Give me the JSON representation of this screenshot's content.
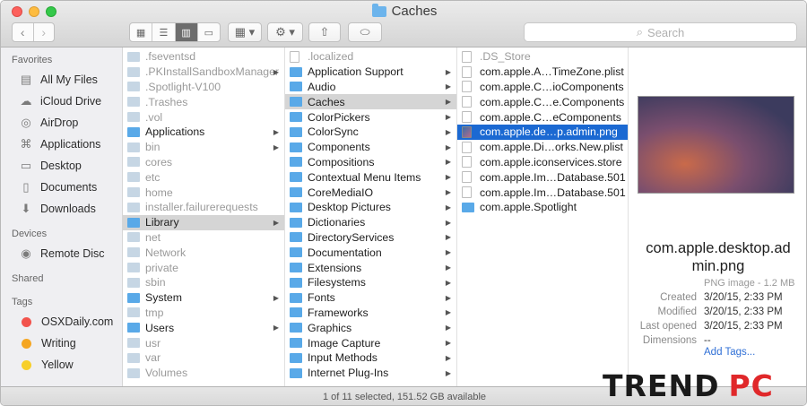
{
  "window": {
    "title": "Caches"
  },
  "toolbar": {
    "search_placeholder": "Search",
    "search_icon": "magnifier"
  },
  "sidebar": {
    "favorites_header": "Favorites",
    "favorites": [
      {
        "label": "All My Files",
        "icon": "all-files-icon"
      },
      {
        "label": "iCloud Drive",
        "icon": "cloud-icon"
      },
      {
        "label": "AirDrop",
        "icon": "airdrop-icon"
      },
      {
        "label": "Applications",
        "icon": "applications-icon"
      },
      {
        "label": "Desktop",
        "icon": "desktop-icon"
      },
      {
        "label": "Documents",
        "icon": "documents-icon"
      },
      {
        "label": "Downloads",
        "icon": "downloads-icon"
      }
    ],
    "devices_header": "Devices",
    "devices": [
      {
        "label": "Remote Disc",
        "icon": "disc-icon"
      }
    ],
    "shared_header": "Shared",
    "tags_header": "Tags",
    "tags": [
      {
        "label": "OSXDaily.com",
        "color": "#f2534c"
      },
      {
        "label": "Writing",
        "color": "#f5a623"
      },
      {
        "label": "Yellow",
        "color": "#f7cf2a"
      }
    ]
  },
  "columns": {
    "col1": [
      {
        "label": ".fseventsd",
        "dim": true,
        "arrow": false
      },
      {
        "label": ".PKInstallSandboxManager",
        "dim": true,
        "arrow": true
      },
      {
        "label": ".Spotlight-V100",
        "dim": true,
        "arrow": false
      },
      {
        "label": ".Trashes",
        "dim": true,
        "arrow": false
      },
      {
        "label": ".vol",
        "dim": true,
        "arrow": false
      },
      {
        "label": "Applications",
        "dim": false,
        "arrow": true
      },
      {
        "label": "bin",
        "dim": true,
        "arrow": true
      },
      {
        "label": "cores",
        "dim": true,
        "arrow": false
      },
      {
        "label": "etc",
        "dim": true,
        "arrow": false
      },
      {
        "label": "home",
        "dim": true,
        "arrow": false
      },
      {
        "label": "installer.failurerequests",
        "dim": true,
        "arrow": false
      },
      {
        "label": "Library",
        "dim": false,
        "arrow": true,
        "selected": true
      },
      {
        "label": "net",
        "dim": true,
        "arrow": false
      },
      {
        "label": "Network",
        "dim": true,
        "arrow": false
      },
      {
        "label": "private",
        "dim": true,
        "arrow": false
      },
      {
        "label": "sbin",
        "dim": true,
        "arrow": false
      },
      {
        "label": "System",
        "dim": false,
        "arrow": true
      },
      {
        "label": "tmp",
        "dim": true,
        "arrow": false
      },
      {
        "label": "Users",
        "dim": false,
        "arrow": true
      },
      {
        "label": "usr",
        "dim": true,
        "arrow": false
      },
      {
        "label": "var",
        "dim": true,
        "arrow": false
      },
      {
        "label": "Volumes",
        "dim": true,
        "arrow": false
      }
    ],
    "col2": [
      {
        "label": ".localized",
        "dim": true,
        "arrow": false,
        "file": true
      },
      {
        "label": "Application Support",
        "arrow": true
      },
      {
        "label": "Audio",
        "arrow": true
      },
      {
        "label": "Caches",
        "arrow": true,
        "selected": true
      },
      {
        "label": "ColorPickers",
        "arrow": true
      },
      {
        "label": "ColorSync",
        "arrow": true
      },
      {
        "label": "Components",
        "arrow": true
      },
      {
        "label": "Compositions",
        "arrow": true
      },
      {
        "label": "Contextual Menu Items",
        "arrow": true
      },
      {
        "label": "CoreMediaIO",
        "arrow": true
      },
      {
        "label": "Desktop Pictures",
        "arrow": true
      },
      {
        "label": "Dictionaries",
        "arrow": true
      },
      {
        "label": "DirectoryServices",
        "arrow": true
      },
      {
        "label": "Documentation",
        "arrow": true
      },
      {
        "label": "Extensions",
        "arrow": true
      },
      {
        "label": "Filesystems",
        "arrow": true
      },
      {
        "label": "Fonts",
        "arrow": true
      },
      {
        "label": "Frameworks",
        "arrow": true
      },
      {
        "label": "Graphics",
        "arrow": true
      },
      {
        "label": "Image Capture",
        "arrow": true
      },
      {
        "label": "Input Methods",
        "arrow": true
      },
      {
        "label": "Internet Plug-Ins",
        "arrow": true
      }
    ],
    "col3": [
      {
        "label": ".DS_Store",
        "dim": true,
        "file": true
      },
      {
        "label": "com.apple.A…TimeZone.plist",
        "file": true
      },
      {
        "label": "com.apple.C…ioComponents",
        "file": true
      },
      {
        "label": "com.apple.C…e.Components",
        "file": true
      },
      {
        "label": "com.apple.C…eComponents",
        "file": true
      },
      {
        "label": "com.apple.de…p.admin.png",
        "file": true,
        "img": true,
        "selected": true
      },
      {
        "label": "com.apple.Di…orks.New.plist",
        "file": true
      },
      {
        "label": "com.apple.iconservices.store",
        "file": true
      },
      {
        "label": "com.apple.Im…Database.501",
        "file": true
      },
      {
        "label": "com.apple.Im…Database.501",
        "file": true
      },
      {
        "label": "com.apple.Spotlight",
        "file": false
      }
    ]
  },
  "preview": {
    "name": "com.apple.desktop.admin.png",
    "kind": "PNG image - 1.2 MB",
    "created_label": "Created",
    "created": "3/20/15, 2:33 PM",
    "modified_label": "Modified",
    "modified": "3/20/15, 2:33 PM",
    "opened_label": "Last opened",
    "opened": "3/20/15, 2:33 PM",
    "dimensions_label": "Dimensions",
    "dimensions": "--",
    "add_tags": "Add Tags..."
  },
  "status": {
    "text": "1 of 11 selected, 151.52 GB available"
  },
  "watermark": {
    "part1": "TREND",
    "part2": "PC"
  }
}
